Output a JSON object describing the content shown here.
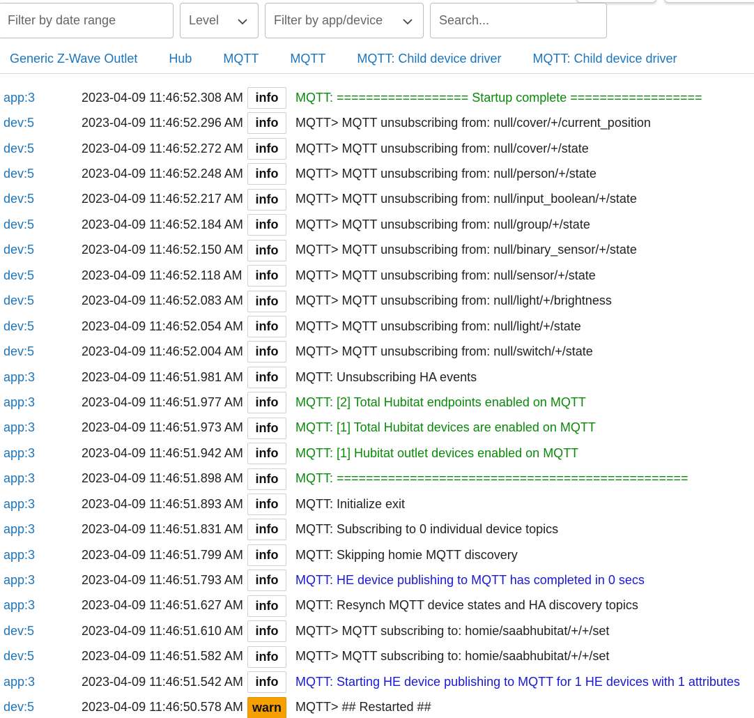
{
  "filters": {
    "date_placeholder": "Filter by date range",
    "level_label": "Level",
    "app_device_label": "Filter by app/device",
    "search_placeholder": "Search..."
  },
  "device_links": [
    "Generic Z-Wave Outlet",
    "Hub",
    "MQTT",
    "MQTT",
    "MQTT: Child device driver",
    "MQTT: Child device driver"
  ],
  "logs": [
    {
      "source": "app:3",
      "time": "2023-04-09 11:46:52.308 AM",
      "level": "info",
      "message": "MQTT: ================== Startup complete ==================",
      "color": "green"
    },
    {
      "source": "dev:5",
      "time": "2023-04-09 11:46:52.296 AM",
      "level": "info",
      "message": "MQTT> MQTT unsubscribing from: null/cover/+/current_position",
      "color": "default"
    },
    {
      "source": "dev:5",
      "time": "2023-04-09 11:46:52.272 AM",
      "level": "info",
      "message": "MQTT> MQTT unsubscribing from: null/cover/+/state",
      "color": "default"
    },
    {
      "source": "dev:5",
      "time": "2023-04-09 11:46:52.248 AM",
      "level": "info",
      "message": "MQTT> MQTT unsubscribing from: null/person/+/state",
      "color": "default"
    },
    {
      "source": "dev:5",
      "time": "2023-04-09 11:46:52.217 AM",
      "level": "info",
      "message": "MQTT> MQTT unsubscribing from: null/input_boolean/+/state",
      "color": "default"
    },
    {
      "source": "dev:5",
      "time": "2023-04-09 11:46:52.184 AM",
      "level": "info",
      "message": "MQTT> MQTT unsubscribing from: null/group/+/state",
      "color": "default"
    },
    {
      "source": "dev:5",
      "time": "2023-04-09 11:46:52.150 AM",
      "level": "info",
      "message": "MQTT> MQTT unsubscribing from: null/binary_sensor/+/state",
      "color": "default"
    },
    {
      "source": "dev:5",
      "time": "2023-04-09 11:46:52.118 AM",
      "level": "info",
      "message": "MQTT> MQTT unsubscribing from: null/sensor/+/state",
      "color": "default"
    },
    {
      "source": "dev:5",
      "time": "2023-04-09 11:46:52.083 AM",
      "level": "info",
      "message": "MQTT> MQTT unsubscribing from: null/light/+/brightness",
      "color": "default"
    },
    {
      "source": "dev:5",
      "time": "2023-04-09 11:46:52.054 AM",
      "level": "info",
      "message": "MQTT> MQTT unsubscribing from: null/light/+/state",
      "color": "default"
    },
    {
      "source": "dev:5",
      "time": "2023-04-09 11:46:52.004 AM",
      "level": "info",
      "message": "MQTT> MQTT unsubscribing from: null/switch/+/state",
      "color": "default"
    },
    {
      "source": "app:3",
      "time": "2023-04-09 11:46:51.981 AM",
      "level": "info",
      "message": "MQTT: Unsubscribing HA events",
      "color": "default"
    },
    {
      "source": "app:3",
      "time": "2023-04-09 11:46:51.977 AM",
      "level": "info",
      "message": "MQTT: [2] Total Hubitat endpoints enabled on MQTT",
      "color": "green"
    },
    {
      "source": "app:3",
      "time": "2023-04-09 11:46:51.973 AM",
      "level": "info",
      "message": "MQTT: [1] Total Hubitat devices are enabled on MQTT",
      "color": "green"
    },
    {
      "source": "app:3",
      "time": "2023-04-09 11:46:51.942 AM",
      "level": "info",
      "message": "MQTT: [1] Hubitat outlet devices enabled on MQTT",
      "color": "green"
    },
    {
      "source": "app:3",
      "time": "2023-04-09 11:46:51.898 AM",
      "level": "info",
      "message": "MQTT: ================================================",
      "color": "green"
    },
    {
      "source": "app:3",
      "time": "2023-04-09 11:46:51.893 AM",
      "level": "info",
      "message": "MQTT: Initialize exit",
      "color": "default"
    },
    {
      "source": "app:3",
      "time": "2023-04-09 11:46:51.831 AM",
      "level": "info",
      "message": "MQTT: Subscribing to 0 individual device topics",
      "color": "default"
    },
    {
      "source": "app:3",
      "time": "2023-04-09 11:46:51.799 AM",
      "level": "info",
      "message": "MQTT: Skipping homie MQTT discovery",
      "color": "default"
    },
    {
      "source": "app:3",
      "time": "2023-04-09 11:46:51.793 AM",
      "level": "info",
      "message": "MQTT: HE device publishing to MQTT has completed in 0 secs",
      "color": "blue"
    },
    {
      "source": "app:3",
      "time": "2023-04-09 11:46:51.627 AM",
      "level": "info",
      "message": "MQTT: Resynch MQTT device states and HA discovery topics",
      "color": "default"
    },
    {
      "source": "dev:5",
      "time": "2023-04-09 11:46:51.610 AM",
      "level": "info",
      "message": "MQTT> MQTT subscribing to: homie/saabhubitat/+/+/set",
      "color": "default"
    },
    {
      "source": "dev:5",
      "time": "2023-04-09 11:46:51.582 AM",
      "level": "info",
      "message": "MQTT> MQTT subscribing to: homie/saabhubitat/+/+/set",
      "color": "default"
    },
    {
      "source": "app:3",
      "time": "2023-04-09 11:46:51.542 AM",
      "level": "info",
      "message": "MQTT: Starting HE device publishing to MQTT for 1 HE devices with 1 attributes",
      "color": "blue"
    },
    {
      "source": "dev:5",
      "time": "2023-04-09 11:46:50.578 AM",
      "level": "warn",
      "message": "MQTT> ## Restarted ##",
      "color": "default"
    }
  ],
  "colors": {
    "link": "#1c75bc",
    "green": "#0a8a0a",
    "blue": "#1818d6",
    "warn": "#f5a000"
  },
  "icons": {
    "level_dropdown": "chevron-down-icon",
    "app_dropdown": "chevron-down-icon"
  }
}
